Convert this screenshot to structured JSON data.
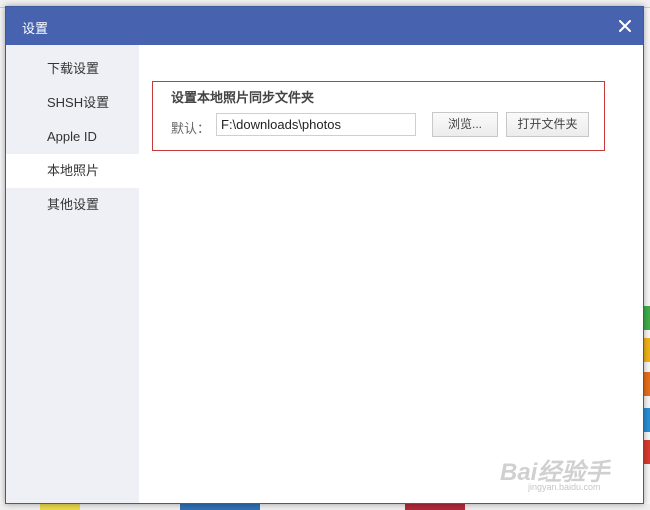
{
  "dialog": {
    "title": "设置",
    "close_icon": "close-icon"
  },
  "sidebar": {
    "items": [
      {
        "label": "下载设置",
        "active": false
      },
      {
        "label": "SHSH设置",
        "active": false
      },
      {
        "label": "Apple ID",
        "active": false
      },
      {
        "label": "本地照片",
        "active": true
      },
      {
        "label": "其他设置",
        "active": false
      }
    ]
  },
  "photo_sync": {
    "title": "设置本地照片同步文件夹",
    "default_label": "默认：",
    "path_value": "F:\\downloads\\photos",
    "browse_label": "浏览...",
    "open_folder_label": "打开文件夹"
  },
  "watermark": {
    "text": "Bai经验手",
    "sub": "jingyan.baidu.com"
  },
  "colors": {
    "titlebar": "#4763b0",
    "sidebar_bg": "#eef0f6",
    "highlight_border": "#c73a3a"
  }
}
